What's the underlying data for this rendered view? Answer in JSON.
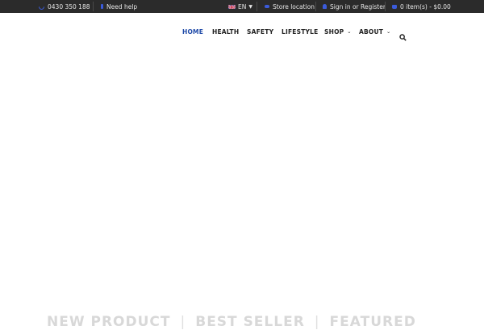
{
  "topbar": {
    "phone": "0430 350 188",
    "help": "Need help",
    "language": "EN",
    "store": "Store location",
    "account": "Sign in or Register",
    "cart": "0 item(s) - $0.00"
  },
  "nav": {
    "items": [
      {
        "label": "HOME",
        "active": true
      },
      {
        "label": "HEALTH"
      },
      {
        "label": "SAFETY"
      },
      {
        "label": "LIFESTYLE"
      },
      {
        "label": "SHOP",
        "dropdown": true
      },
      {
        "label": "ABOUT",
        "dropdown": true
      }
    ]
  },
  "product_tabs": {
    "tab1": "NEW PRODUCT",
    "tab2": "BEST SELLER",
    "tab3": "FEATURED"
  },
  "colors": {
    "topbar_bg": "#2b2b2b",
    "accent": "#1f4aa8",
    "icon_blue": "#3b5bdb"
  }
}
